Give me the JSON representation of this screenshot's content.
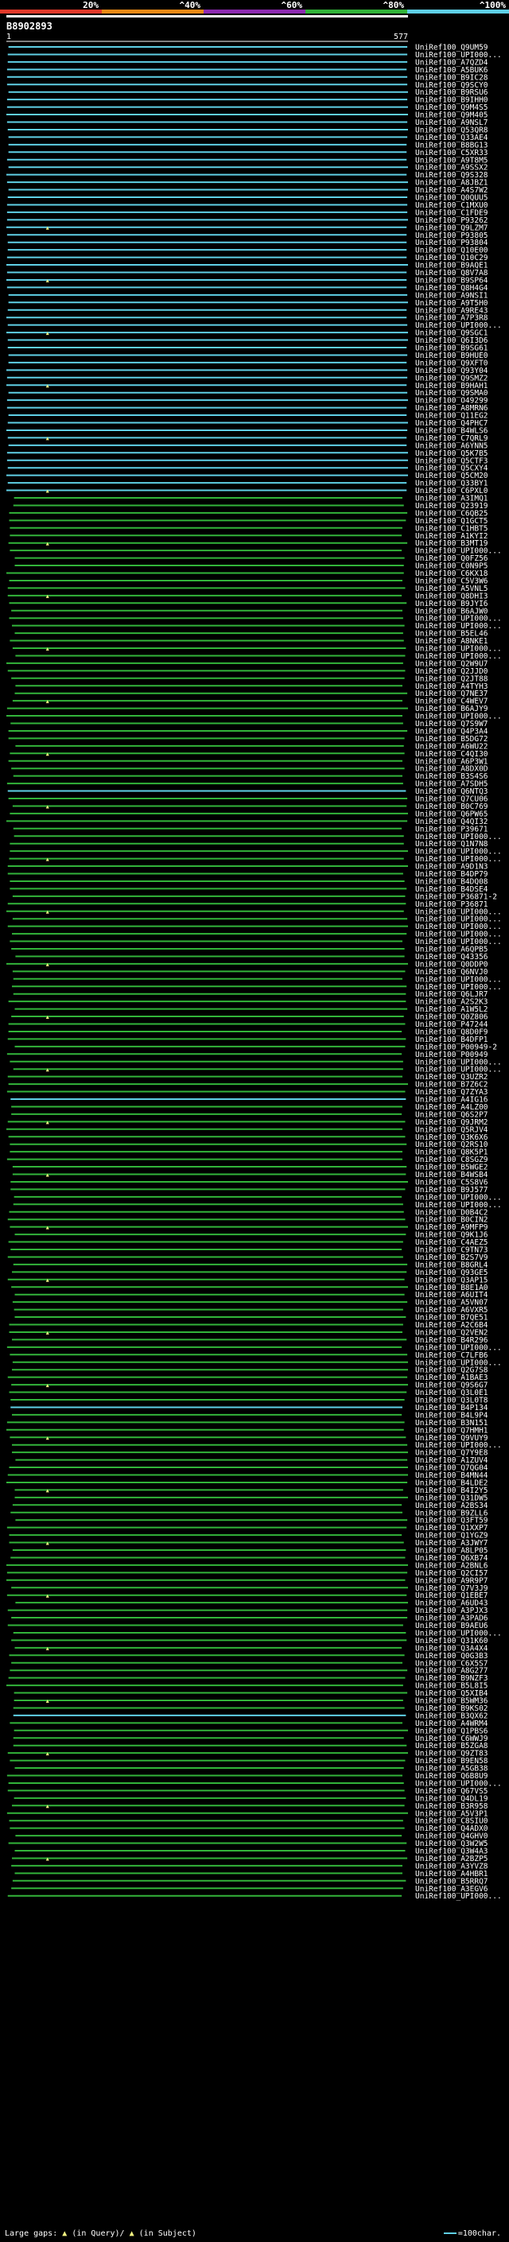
{
  "chart_data": {
    "type": "bar",
    "query_id": "B8902893",
    "axis_start": "1",
    "axis_end": "577",
    "scale_ticks": [
      "20%",
      "^40%",
      "^60%",
      "^80%",
      "^100%"
    ],
    "identity_bands": [
      {
        "range": [
          0,
          20
        ],
        "color": "#e23a2b"
      },
      {
        "range": [
          20,
          40
        ],
        "color": "#e98a16"
      },
      {
        "range": [
          40,
          60
        ],
        "color": "#8e2bb1"
      },
      {
        "range": [
          60,
          80
        ],
        "color": "#32b43a"
      },
      {
        "range": [
          80,
          100
        ],
        "color": "#5fd0e6"
      }
    ],
    "query_length": 577,
    "rows_identity_gt80": 60,
    "hits": [
      "UniRef100_Q9UM59",
      "UniRef100_UPI000...",
      "UniRef100_A7QZD4",
      "UniRef100_A5BUK6",
      "UniRef100_B9IC28",
      "UniRef100_Q9SCY0",
      "UniRef100_B9RSU6",
      "UniRef100_B9IHH0",
      "UniRef100_Q9M4S5",
      "UniRef100_Q9M405",
      "UniRef100_A9NSL7",
      "UniRef100_Q53QR8",
      "UniRef100_Q33AE4",
      "UniRef100_B8BG13",
      "UniRef100_C5XR33",
      "UniRef100_A9T8M5",
      "UniRef100_A9SSX2",
      "UniRef100_Q9S328",
      "UniRef100_A8JBZ1",
      "UniRef100_A4S7W2",
      "UniRef100_Q0QUU5",
      "UniRef100_C1MXU0",
      "UniRef100_C1FDE9",
      "UniRef100_P93262",
      "UniRef100_Q9LZM7",
      "UniRef100_P93805",
      "UniRef100_P93804",
      "UniRef100_Q10E00",
      "UniRef100_Q10C29",
      "UniRef100_B9AQE1",
      "UniRef100_Q8V7A8",
      "UniRef100_B9SP64",
      "UniRef100_Q8H4G4",
      "UniRef100_A9NSI1",
      "UniRef100_A9T5H0",
      "UniRef100_A9RE43",
      "UniRef100_A7P3R8",
      "UniRef100_UPI000...",
      "UniRef100_Q9SGC1",
      "UniRef100_Q6I3D6",
      "UniRef100_B9SG61",
      "UniRef100_B9HUE0",
      "UniRef100_Q9XFT0",
      "UniRef100_Q93Y04",
      "UniRef100_Q9SMZ2",
      "UniRef100_B9HAH1",
      "UniRef100_Q9SMA0",
      "UniRef100_O49299",
      "UniRef100_A8MRN6",
      "UniRef100_Q11EG2",
      "UniRef100_Q4PHC7",
      "UniRef100_B4WLS6",
      "UniRef100_C7QRL9",
      "UniRef100_A6YNN5",
      "UniRef100_Q5K7B5",
      "UniRef100_Q5CTF3",
      "UniRef100_Q5CXY4",
      "UniRef100_Q5CM20",
      "UniRef100_Q33BY1",
      "UniRef100_C6PXL0",
      "UniRef100_A3IMQ1",
      "UniRef100_Q23919",
      "UniRef100_C6QB25",
      "UniRef100_Q1GCT5",
      "UniRef100_C1HBT5",
      "UniRef100_A1KYI2",
      "UniRef100_B3MT19",
      "UniRef100_UPI000...",
      "UniRef100_Q0FZ56",
      "UniRef100_C0N9P5",
      "UniRef100_C6KX18",
      "UniRef100_C5V3W6",
      "UniRef100_A5VNL5",
      "UniRef100_Q8DHI3",
      "UniRef100_B9JYI6",
      "UniRef100_B6AJW0",
      "UniRef100_UPI000...",
      "UniRef100_UPI000...",
      "UniRef100_B5EL46",
      "UniRef100_A8NKE1",
      "UniRef100_UPI000...",
      "UniRef100_UPI000...",
      "UniRef100_Q2W9U7",
      "UniRef100_Q2JJD0",
      "UniRef100_Q2JT88",
      "UniRef100_A4TYH3",
      "UniRef100_Q7NE37",
      "UniRef100_C4WEV7",
      "UniRef100_B6AJY9",
      "UniRef100_UPI000...",
      "UniRef100_Q7S9W7",
      "UniRef100_Q4P3A4",
      "UniRef100_B5DG72",
      "UniRef100_A6WU22",
      "UniRef100_C4QI30",
      "UniRef100_A6P3W1",
      "UniRef100_A8DX0D",
      "UniRef100_B3S4S6",
      "UniRef100_A7SDH5",
      "UniRef100_Q6NTQ3",
      "UniRef100_Q7CU06",
      "UniRef100_B0C769",
      "UniRef100_Q6PW65",
      "UniRef100_Q4QI32",
      "UniRef100_P39671",
      "UniRef100_UPI000...",
      "UniRef100_Q1N7N8",
      "UniRef100_UPI000...",
      "UniRef100_UPI000...",
      "UniRef100_A9D1N3",
      "UniRef100_B4DP79",
      "UniRef100_B4DQ08",
      "UniRef100_B4DSE4",
      "UniRef100_P36871-2",
      "UniRef100_P36871",
      "UniRef100_UPI000...",
      "UniRef100_UPI000...",
      "UniRef100_UPI000...",
      "UniRef100_UPI000...",
      "UniRef100_UPI000...",
      "UniRef100_A6QPB5",
      "UniRef100_Q43356",
      "UniRef100_Q0DDP0",
      "UniRef100_Q6NVJ0",
      "UniRef100_UPI000...",
      "UniRef100_UPI000...",
      "UniRef100_Q6LJR7",
      "UniRef100_A2S2K3",
      "UniRef100_A1W5L2",
      "UniRef100_Q0Z806",
      "UniRef100_P47244",
      "UniRef100_Q8D0F9",
      "UniRef100_B4DFP1",
      "UniRef100_P00949-2",
      "UniRef100_P00949",
      "UniRef100_UPI000...",
      "UniRef100_UPI000...",
      "UniRef100_Q3UZR2",
      "UniRef100_B7Z6C2",
      "UniRef100_Q7ZYA3",
      "UniRef100_A4IG16",
      "UniRef100_A4LZ00",
      "UniRef100_Q6S2P7",
      "UniRef100_Q9JRM2",
      "UniRef100_Q5RJV4",
      "UniRef100_Q3K6X6",
      "UniRef100_Q2RS10",
      "UniRef100_Q8K5P1",
      "UniRef100_C8SGZ9",
      "UniRef100_B5WGE2",
      "UniRef100_B4WSB4",
      "UniRef100_C5S8V6",
      "UniRef100_B9J577",
      "UniRef100_UPI000...",
      "UniRef100_UPI000...",
      "UniRef100_D0B4C2",
      "UniRef100_B0CIN2",
      "UniRef100_A9MFP9",
      "UniRef100_Q9K1J6",
      "UniRef100_C4AEZ5",
      "UniRef100_C9TN73",
      "UniRef100_B2S7V9",
      "UniRef100_B8GRL4",
      "UniRef100_Q93GE5",
      "UniRef100_Q3AP15",
      "UniRef100_B8E1A0",
      "UniRef100_A6UIT4",
      "UniRef100_A5VN07",
      "UniRef100_A6VXR5",
      "UniRef100_B7QE51",
      "UniRef100_A2C6B4",
      "UniRef100_Q2VEN2",
      "UniRef100_B4R296",
      "UniRef100_UPI000...",
      "UniRef100_C7LFB6",
      "UniRef100_UPI000...",
      "UniRef100_Q2G7S8",
      "UniRef100_A1BAE3",
      "UniRef100_Q9S6G7",
      "UniRef100_Q3L0E1",
      "UniRef100_Q3L0T8",
      "UniRef100_B4P134",
      "UniRef100_B4L9P4",
      "UniRef100_B3N151",
      "UniRef100_Q7HMH1",
      "UniRef100_Q9VUY9",
      "UniRef100_UPI000...",
      "UniRef100_Q7Y9E8",
      "UniRef100_A1ZUV4",
      "UniRef100_Q7QG04",
      "UniRef100_B4MN44",
      "UniRef100_B4LDE2",
      "UniRef100_B4I2Y5",
      "UniRef100_Q31DW5",
      "UniRef100_A2BS34",
      "UniRef100_B9ZLL6",
      "UniRef100_Q3FT59",
      "UniRef100_Q1XXP7",
      "UniRef100_Q1YGZ9",
      "UniRef100_A3JWY7",
      "UniRef100_A8LP05",
      "UniRef100_Q6XB74",
      "UniRef100_A2BNL6",
      "UniRef100_Q2CI57",
      "UniRef100_A9R9P7",
      "UniRef100_Q7V3J9",
      "UniRef100_Q1EBE7",
      "UniRef100_A6UD43",
      "UniRef100_A3PJX3",
      "UniRef100_A3PAD6",
      "UniRef100_B9AEU6",
      "UniRef100_UPI000...",
      "UniRef100_Q31K60",
      "UniRef100_Q3A4X4",
      "UniRef100_Q0G3B3",
      "UniRef100_C6X5S7",
      "UniRef100_A8G277",
      "UniRef100_B9NZF3",
      "UniRef100_B5L8I5",
      "UniRef100_Q5XIB4",
      "UniRef100_B5WM36",
      "UniRef100_B9KS02",
      "UniRef100_B3QX62",
      "UniRef100_A4WRM4",
      "UniRef100_Q1PBS6",
      "UniRef100_C6WWJ9",
      "UniRef100_B5ZGA8",
      "UniRef100_Q9ZT83",
      "UniRef100_B9EN58",
      "UniRef100_A5GB38",
      "UniRef100_Q6B8U9",
      "UniRef100_UPI000...",
      "UniRef100_Q67VS5",
      "UniRef100_Q4DL19",
      "UniRef100_B3R958",
      "UniRef100_A5V3P1",
      "UniRef100_C8SIU0",
      "UniRef100_Q4ADX0",
      "UniRef100_Q4GHV0",
      "UniRef100_Q3W2W5",
      "UniRef100_Q3W4A3",
      "UniRef100_A2BZP5",
      "UniRef100_A3YVZ8",
      "UniRef100_A4HBR1",
      "UniRef100_B5RRQ7",
      "UniRef100_A3EGV6",
      "UniRef100_UPI000..."
    ]
  },
  "legend": {
    "large_gaps_label": "Large gaps:",
    "in_query_text": "(in Query)/",
    "in_subject_text": "(in Subject)",
    "scale_text": "=100char."
  }
}
